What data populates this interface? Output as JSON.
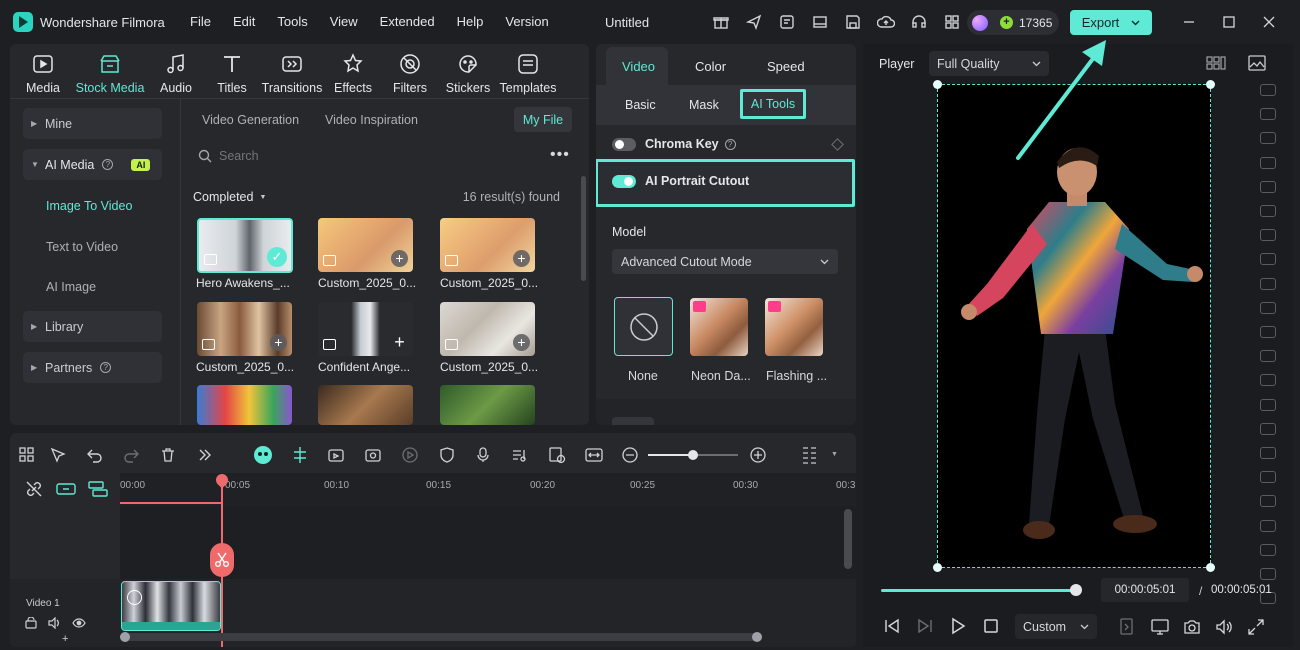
{
  "app": {
    "name": "Wondershare Filmora",
    "menu": [
      "File",
      "Edit",
      "Tools",
      "View",
      "Extended",
      "Help",
      "Version"
    ],
    "project_title": "Untitled",
    "credits": "17365",
    "export_label": "Export",
    "accent": "#5eead4"
  },
  "media_tabs": [
    {
      "label": "Media",
      "icon": "media-icon"
    },
    {
      "label": "Stock Media",
      "icon": "stock-media-icon"
    },
    {
      "label": "Audio",
      "icon": "audio-icon"
    },
    {
      "label": "Titles",
      "icon": "titles-icon"
    },
    {
      "label": "Transitions",
      "icon": "transitions-icon"
    },
    {
      "label": "Effects",
      "icon": "effects-icon"
    },
    {
      "label": "Filters",
      "icon": "filters-icon"
    },
    {
      "label": "Stickers",
      "icon": "stickers-icon"
    },
    {
      "label": "Templates",
      "icon": "templates-icon"
    }
  ],
  "sidebar": {
    "mine": "Mine",
    "ai_media": "AI Media",
    "ai_badge": "AI",
    "image_to_video": "Image To Video",
    "text_to_video": "Text to Video",
    "ai_image": "AI Image",
    "library": "Library",
    "partners": "Partners"
  },
  "browser": {
    "tabs": [
      "Video Generation",
      "Video Inspiration"
    ],
    "my_file": "My File",
    "search_placeholder": "Search",
    "filter": "Completed",
    "results": "16 result(s) found",
    "items": [
      {
        "label": "Hero Awakens_..."
      },
      {
        "label": "Custom_2025_0..."
      },
      {
        "label": "Custom_2025_0..."
      },
      {
        "label": "Custom_2025_0..."
      },
      {
        "label": "Confident Ange..."
      },
      {
        "label": "Custom_2025_0..."
      }
    ]
  },
  "properties": {
    "tabs": [
      "Video",
      "Color",
      "Speed"
    ],
    "subtabs": [
      "Basic",
      "Mask",
      "AI Tools"
    ],
    "chroma_key": "Chroma Key",
    "ai_portrait_cutout": "AI Portrait Cutout",
    "model_label": "Model",
    "model_value": "Advanced Cutout Mode",
    "presets": [
      "None",
      "Neon Da...",
      "Flashing ..."
    ]
  },
  "player": {
    "label": "Player",
    "quality": "Full Quality",
    "current_time": "00:00:05:01",
    "separator": "/",
    "total_time": "00:00:05:01",
    "zoom": "Custom",
    "progress": 1.0
  },
  "timeline": {
    "ruler": [
      "00:00",
      "00:05",
      "00:10",
      "00:15",
      "00:20",
      "00:25",
      "00:30",
      "00:3"
    ],
    "track_label": "Video 1"
  }
}
